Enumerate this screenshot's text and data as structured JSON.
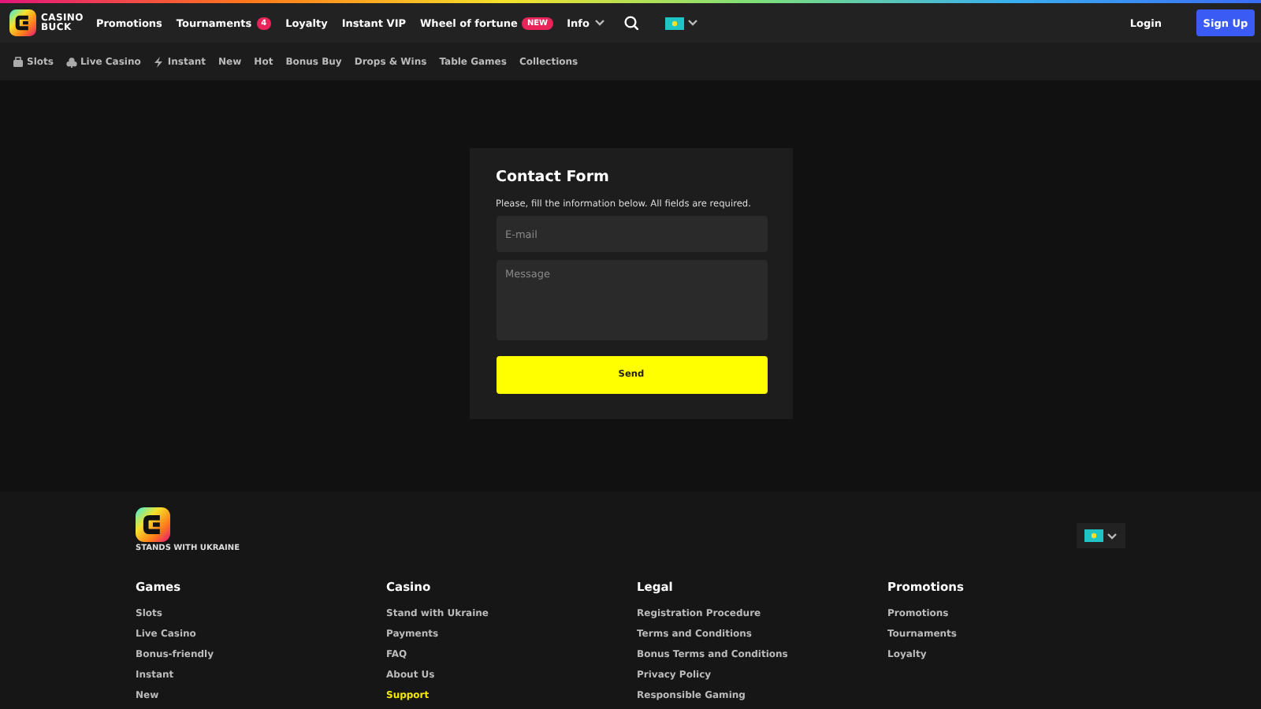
{
  "header": {
    "logo": {
      "line_1": "CASINO",
      "line_2": "BUCK"
    },
    "nav": [
      {
        "label": "Promotions"
      },
      {
        "label": "Tournaments",
        "badge": "4"
      },
      {
        "label": "Loyalty"
      },
      {
        "label": "Instant VIP"
      },
      {
        "label": "Wheel of fortune",
        "badge": "NEW"
      },
      {
        "label": "Info",
        "dropdown": true
      }
    ],
    "login": "Login",
    "signup": "Sign Up"
  },
  "subnav": [
    {
      "label": "Slots"
    },
    {
      "label": "Live Casino"
    },
    {
      "label": "Instant"
    },
    {
      "label": "New"
    },
    {
      "label": "Hot"
    },
    {
      "label": "Bonus Buy"
    },
    {
      "label": "Drops & Wins"
    },
    {
      "label": "Table Games"
    },
    {
      "label": "Collections"
    }
  ],
  "contact_form": {
    "title": "Contact Form",
    "description": "Please, fill the information below. All fields are required.",
    "email": {
      "placeholder": "E-mail"
    },
    "message": {
      "placeholder": "Message"
    },
    "send": "Send"
  },
  "footer": {
    "logo_caption": "STANDS WITH UKRAINE",
    "columns": [
      {
        "heading": "Games",
        "links": [
          {
            "label": "Slots",
            "highlighted": false
          },
          {
            "label": "Live Casino",
            "highlighted": false
          },
          {
            "label": "Bonus-friendly",
            "highlighted": false
          },
          {
            "label": "Instant",
            "highlighted": false
          },
          {
            "label": "New",
            "highlighted": false
          }
        ]
      },
      {
        "heading": "Casino",
        "links": [
          {
            "label": "Stand with Ukraine",
            "highlighted": false
          },
          {
            "label": "Payments",
            "highlighted": false
          },
          {
            "label": "FAQ",
            "highlighted": false
          },
          {
            "label": "About Us",
            "highlighted": false
          },
          {
            "label": "Support",
            "highlighted": true
          }
        ]
      },
      {
        "heading": "Legal",
        "links": [
          {
            "label": "Registration Procedure",
            "highlighted": false
          },
          {
            "label": "Terms and Conditions",
            "highlighted": false
          },
          {
            "label": "Bonus Terms and Conditions",
            "highlighted": false
          },
          {
            "label": "Privacy Policy",
            "highlighted": false
          },
          {
            "label": "Responsible Gaming",
            "highlighted": false
          }
        ]
      },
      {
        "heading": "Promotions",
        "links": [
          {
            "label": "Promotions",
            "highlighted": false
          },
          {
            "label": "Tournaments",
            "highlighted": false
          },
          {
            "label": "Loyalty",
            "highlighted": false
          }
        ]
      }
    ]
  }
}
